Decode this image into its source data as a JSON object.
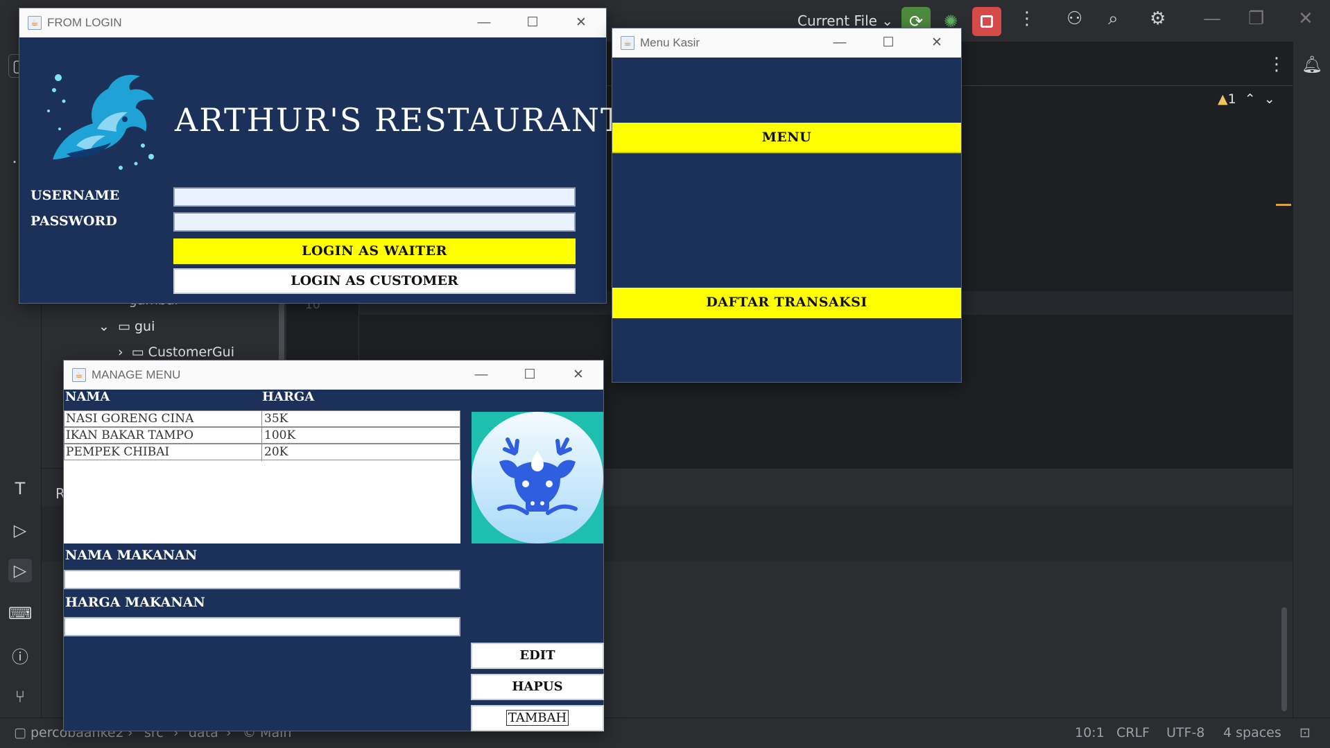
{
  "ide": {
    "run_config": "Current File",
    "tree": {
      "folder_gambar": "gambar",
      "folder_gui": "gui",
      "class_customer_gui": "CustomerGui"
    },
    "line_number": "10",
    "warning_count": "1",
    "bottom_label": "R",
    "statusbar": {
      "breadcrumb": [
        "percobaanke2",
        "src",
        "data",
        "Main"
      ],
      "position": "10:1",
      "line_ending": "CRLF",
      "encoding": "UTF-8",
      "indent": "4 spaces"
    },
    "colors": {
      "run_green": "#4e8a3e",
      "stop_red": "#d74a4a",
      "background": "#1e1f22"
    }
  },
  "login_window": {
    "title": "FROM LOGIN",
    "app_name": "ARTHUR'S RESTAURANT",
    "username_label": "USERNAME",
    "password_label": "PASSWORD",
    "username_value": "",
    "password_value": "",
    "login_waiter": "LOGIN AS WAITER",
    "login_customer": "LOGIN AS CUSTOMER",
    "logo_icon": "dragon-logo-icon"
  },
  "kasir_window": {
    "title": "Menu Kasir",
    "menu_button": "MENU",
    "transaksi_button": "DAFTAR TRANSAKSI"
  },
  "manage_window": {
    "title": "MANAGE MENU",
    "columns": [
      "NAMA",
      "HARGA"
    ],
    "rows": [
      {
        "nama": "NASI GORENG CINA",
        "harga": "35K"
      },
      {
        "nama": "IKAN BAKAR TAMPO",
        "harga": "100K"
      },
      {
        "nama": "PEMPEK CHIBAI",
        "harga": "20K"
      }
    ],
    "nama_label": "NAMA MAKANAN",
    "harga_label": "HARGA MAKANAN",
    "nama_value": "",
    "harga_value": "",
    "edit_button": "EDIT",
    "hapus_button": "HAPUS",
    "tambah_button": "TAMBAH",
    "logo_icon": "bull-logo-icon"
  },
  "window_controls": {
    "minimize": "—",
    "maximize": "☐",
    "close": "✕"
  },
  "colors": {
    "panel_navy": "#1b3159",
    "button_yellow": "#ffff00",
    "logo_teal": "#1fbfb0"
  }
}
